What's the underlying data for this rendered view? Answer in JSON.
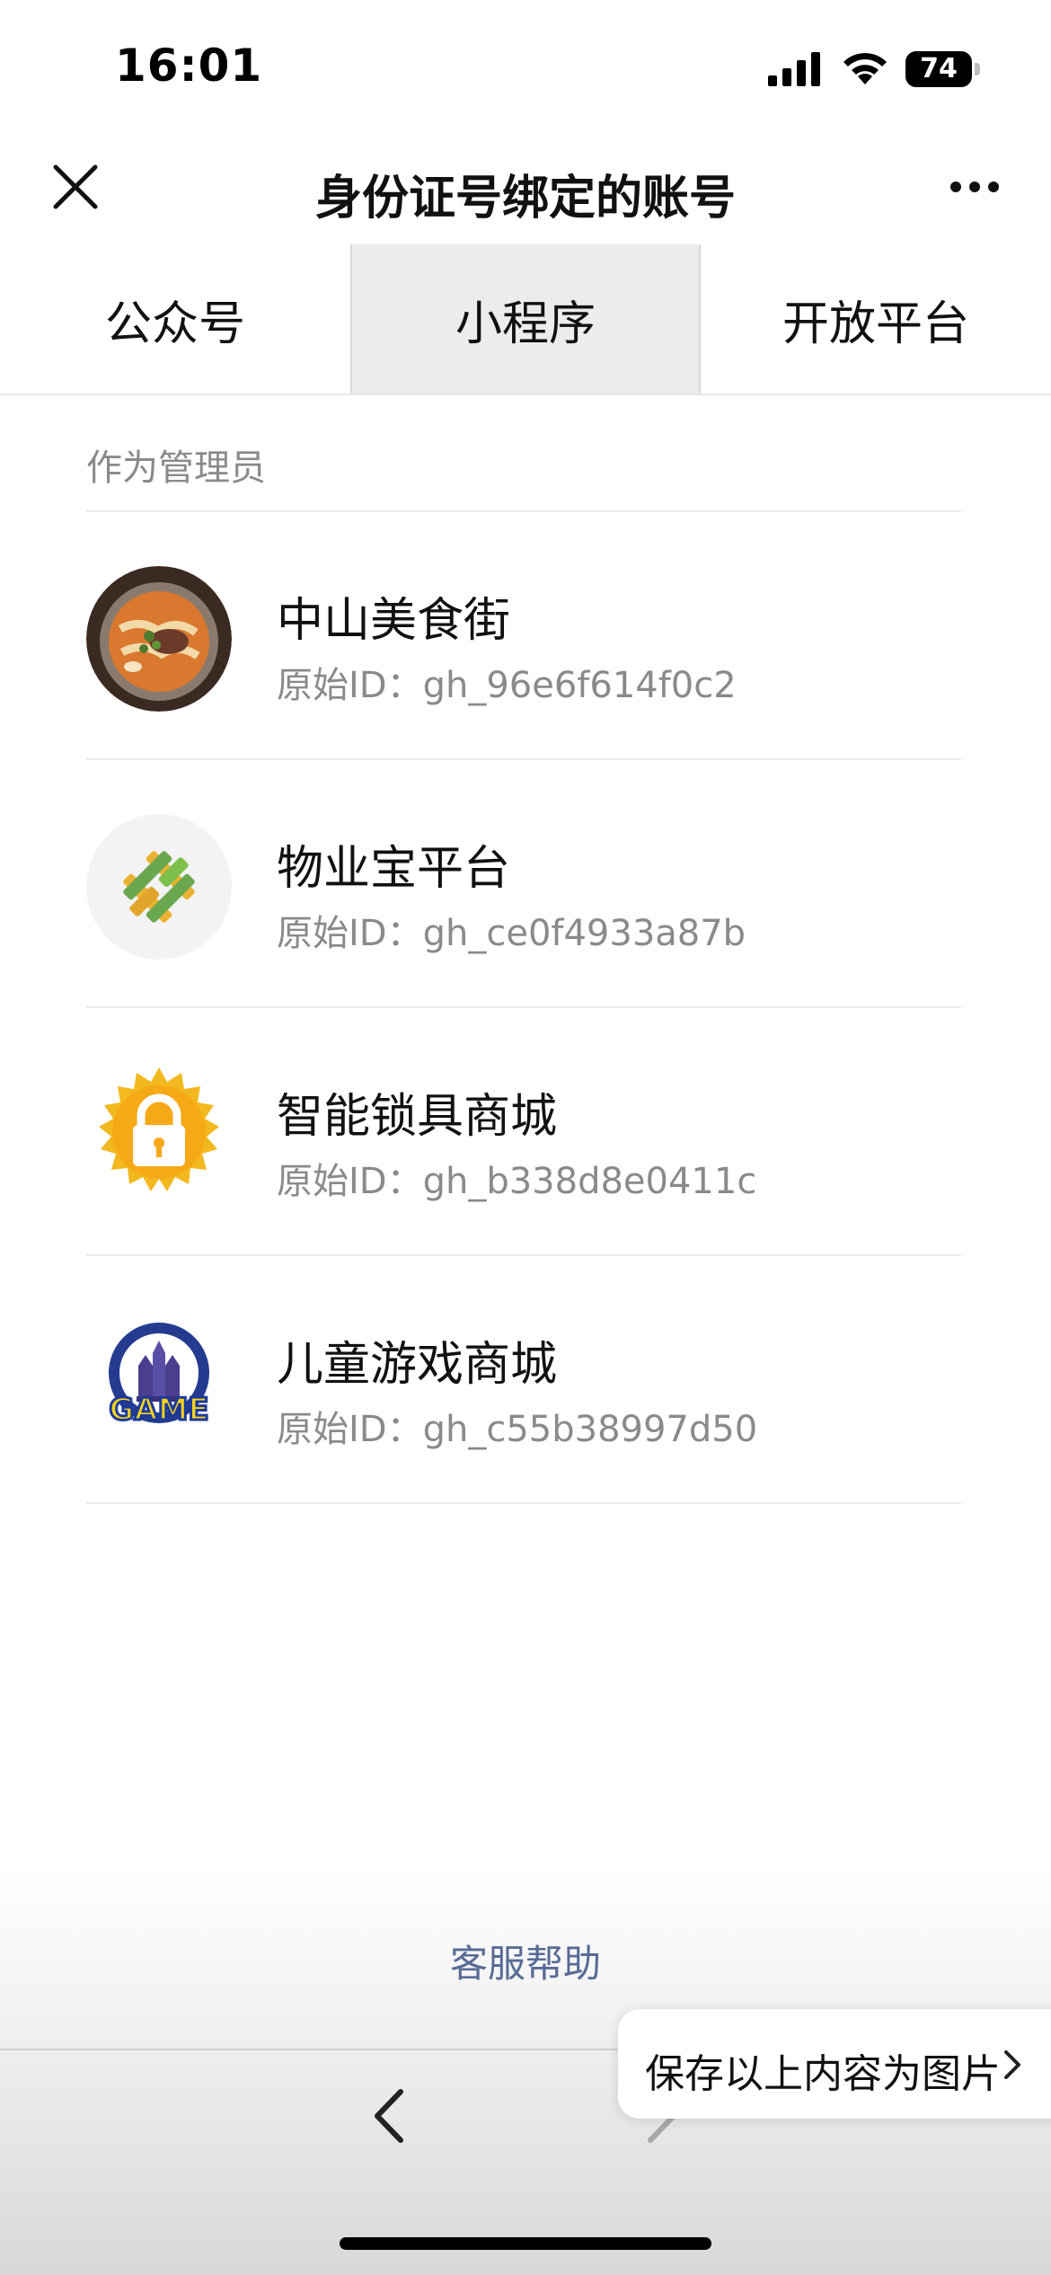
{
  "status_bar": {
    "time": "16:01",
    "battery": "74",
    "icons": [
      "signal-icon",
      "wifi-icon",
      "battery-icon"
    ]
  },
  "nav": {
    "title": "身份证号绑定的账号",
    "left_icon": "close-icon",
    "right_icon": "more-icon"
  },
  "tabs": [
    {
      "label": "公众号",
      "active": false
    },
    {
      "label": "小程序",
      "active": true
    },
    {
      "label": "开放平台",
      "active": false
    }
  ],
  "section": {
    "label": "作为管理员"
  },
  "items": [
    {
      "name": "中山美食街",
      "id_text": "原始ID：gh_96e6f614f0c2",
      "icon": "food-bowl-avatar"
    },
    {
      "name": "物业宝平台",
      "id_text": "原始ID：gh_ce0f4933a87b",
      "icon": "woven-logo-avatar"
    },
    {
      "name": "智能锁具商城",
      "id_text": "原始ID：gh_b338d8e0411c",
      "icon": "lock-badge-avatar"
    },
    {
      "name": "儿童游戏商城",
      "id_text": "原始ID：gh_c55b38997d50",
      "icon": "game-castle-avatar",
      "logo_text": "GAME"
    }
  ],
  "footer": {
    "help_link": "客服帮助",
    "save_popup": "保存以上内容为图片"
  },
  "colors": {
    "link": "#576b95",
    "secondary_text": "#8a8a8a",
    "active_tab_bg": "#ececec"
  }
}
